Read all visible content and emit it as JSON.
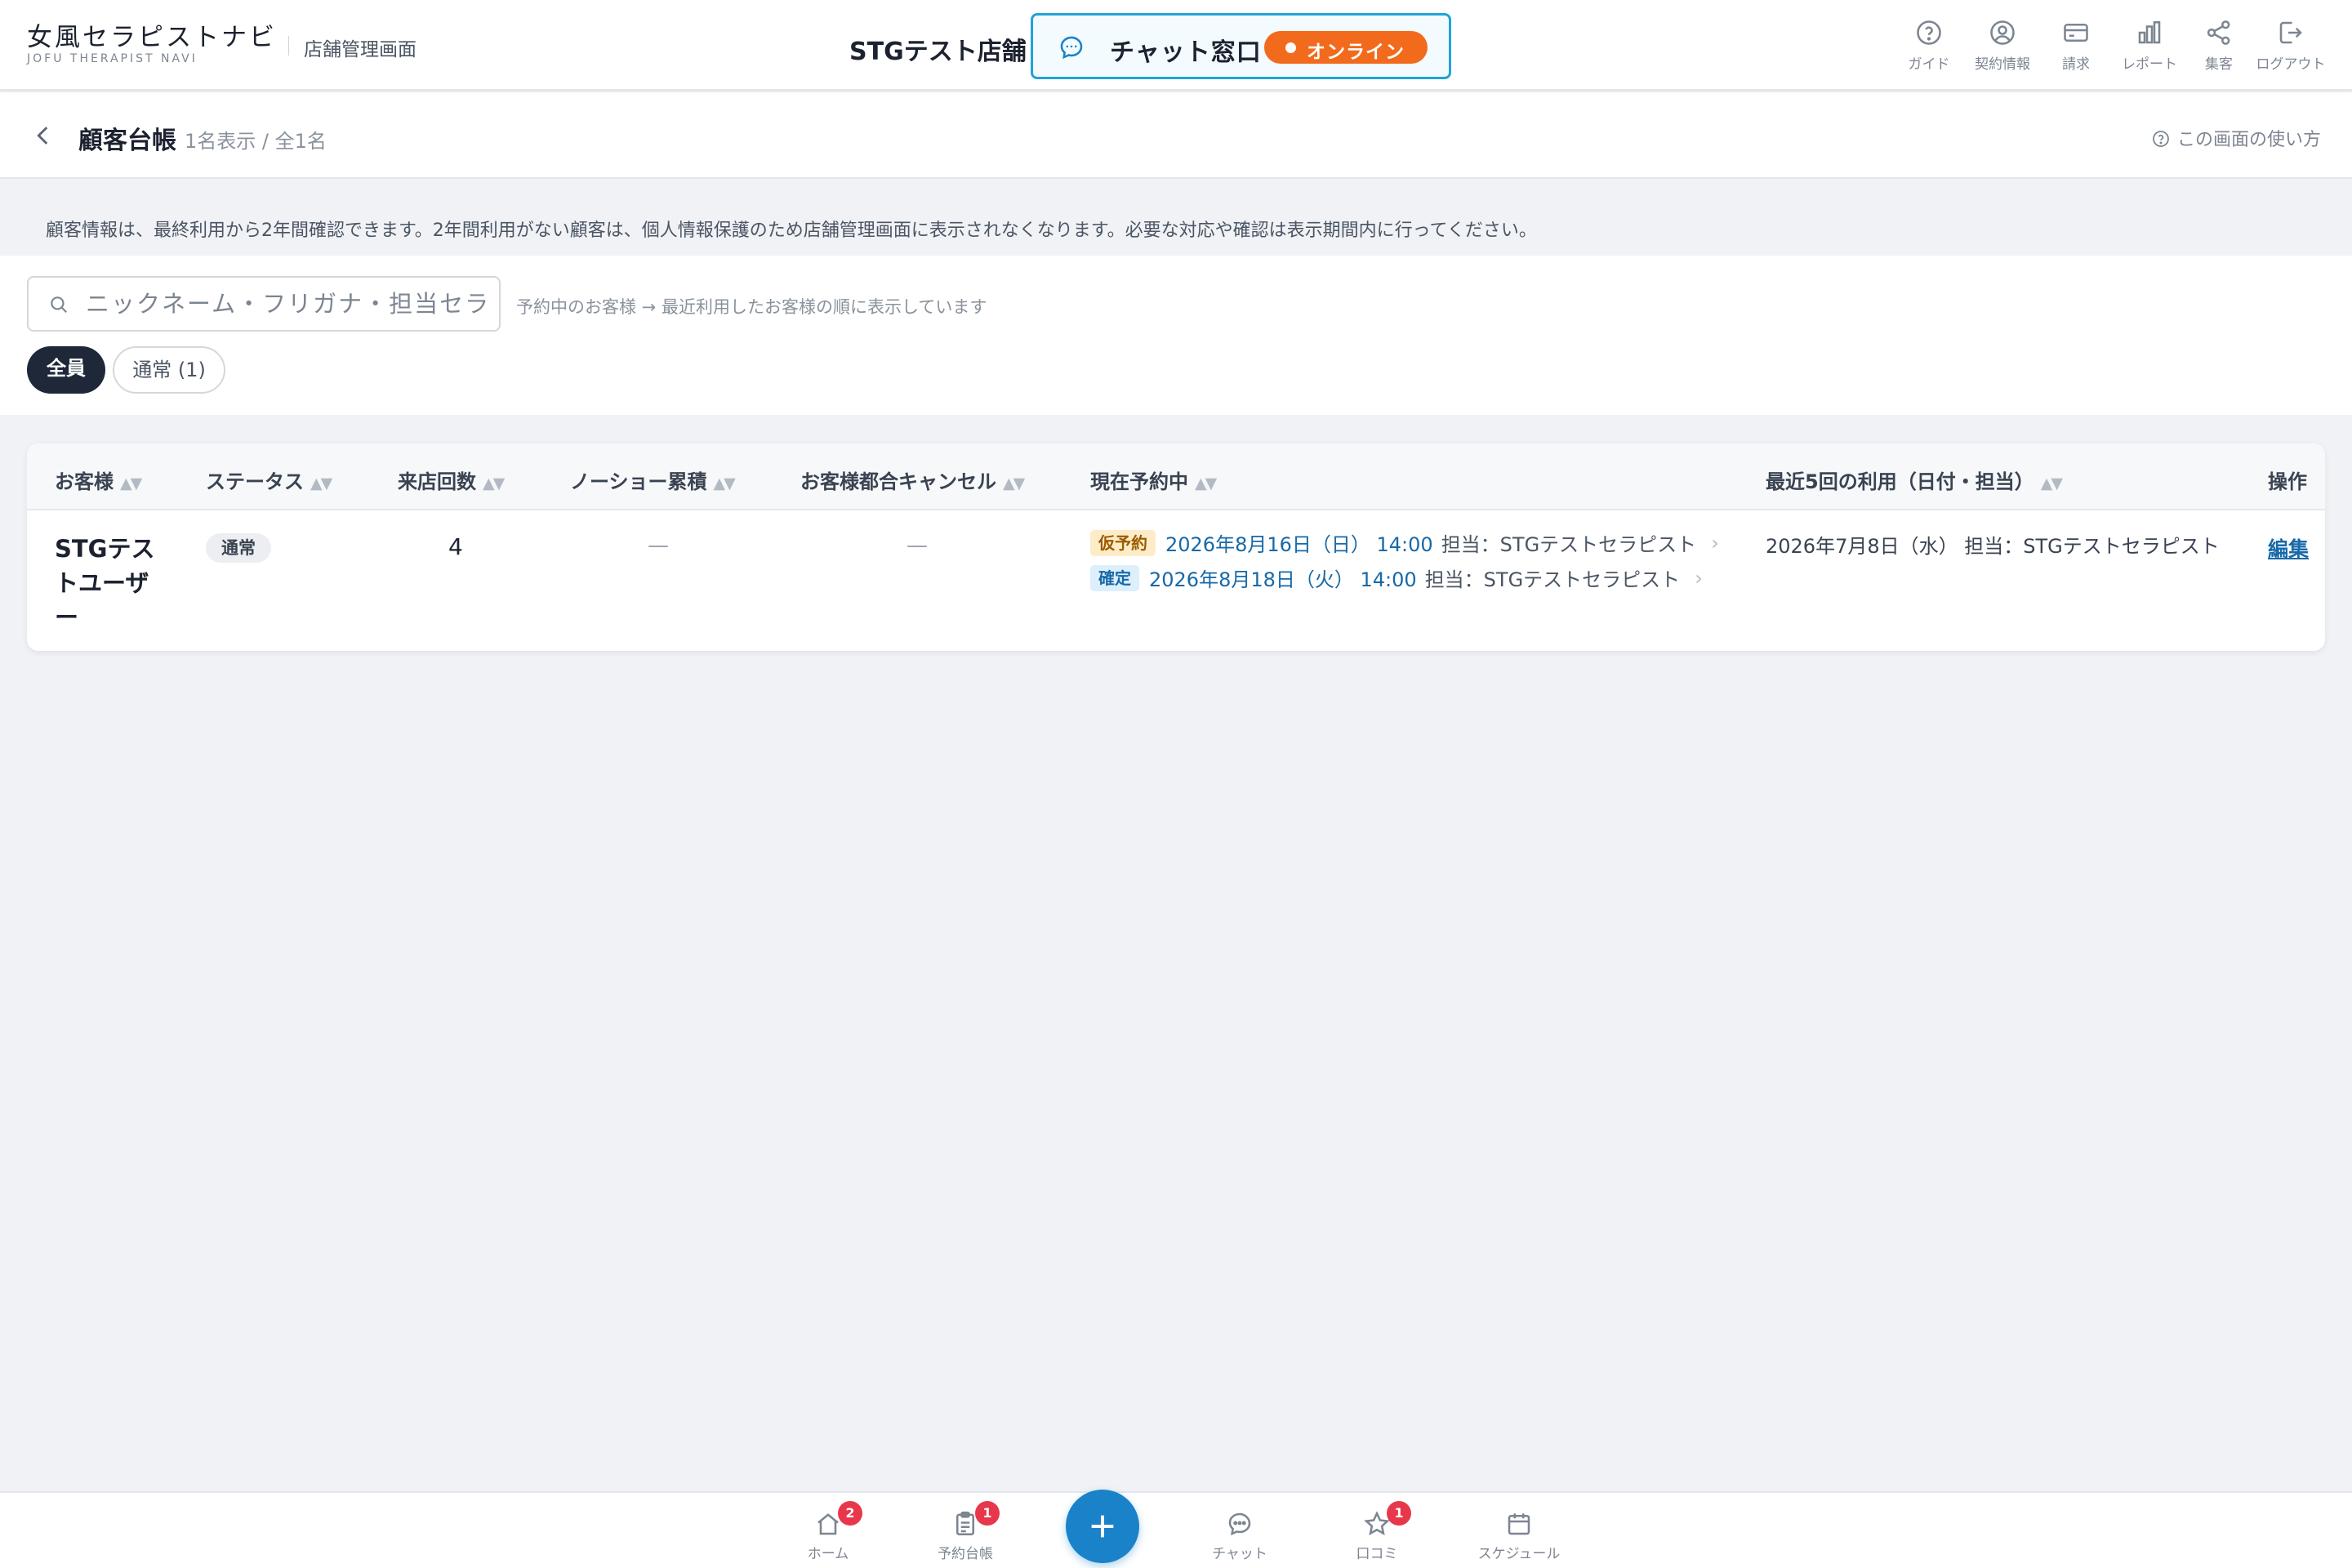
{
  "header": {
    "logo": "女風セラピストナビ",
    "logo_sub": "JOFU THERAPIST NAVI",
    "admin_label": "店舗管理画面",
    "store_name": "STGテスト店舗",
    "chat_label": "チャット窓口",
    "chat_status": "オンライン",
    "nav": [
      {
        "label": "ガイド",
        "icon": "question-circle-icon"
      },
      {
        "label": "契約情報",
        "icon": "user-circle-icon"
      },
      {
        "label": "請求",
        "icon": "credit-card-icon"
      },
      {
        "label": "レポート",
        "icon": "bar-chart-icon"
      },
      {
        "label": "集客",
        "icon": "share-icon"
      },
      {
        "label": "ログアウト",
        "icon": "logout-icon"
      }
    ]
  },
  "page": {
    "title": "顧客台帳",
    "count": "1名表示 / 全1名",
    "help": "この画面の使い方"
  },
  "notice": "顧客情報は、最終利用から2年間確認できます。2年間利用がない顧客は、個人情報保護のため店舗管理画面に表示されなくなります。必要な対応や確認は表示期間内に行ってください。",
  "search": {
    "placeholder": "ニックネーム・フリガナ・担当セラピスト",
    "hint": "予約中のお客様 → 最近利用したお客様の順に表示しています"
  },
  "filters": {
    "all": "全員",
    "normal": "通常 (1)"
  },
  "table": {
    "headers": {
      "customer": "お客様",
      "status": "ステータス",
      "visits": "来店回数",
      "noshow": "ノーショー累積",
      "cancel": "お客様都合キャンセル",
      "current": "現在予約中",
      "recent": "最近5回の利用（日付・担当）",
      "action": "操作"
    },
    "sort_glyph": "▲▼",
    "rows": [
      {
        "name": "STGテストユーザー",
        "status": "通常",
        "visits": "4",
        "noshow": "—",
        "cancel": "—",
        "reservations": [
          {
            "tag": "仮予約",
            "date": "2026年8月16日（日） 14:00",
            "staff": "担当：STGテストセラピスト"
          },
          {
            "tag": "確定",
            "date": "2026年8月18日（火） 14:00",
            "staff": "担当：STGテストセラピスト"
          }
        ],
        "recent": "2026年7月8日（水） 担当：STGテストセラピスト",
        "action": "編集"
      }
    ]
  },
  "bottom_nav": [
    {
      "label": "ホーム",
      "badge": "2",
      "icon": "home-icon"
    },
    {
      "label": "予約台帳",
      "badge": "1",
      "icon": "clipboard-icon"
    },
    {
      "label": "チャット",
      "badge": "",
      "icon": "chat-bubble-icon"
    },
    {
      "label": "口コミ",
      "badge": "1",
      "icon": "star-icon"
    },
    {
      "label": "スケジュール",
      "badge": "",
      "icon": "calendar-icon"
    }
  ],
  "colors": {
    "accent": "#1a82c8",
    "online": "#f26b1d",
    "chat_border": "#1ea5d8",
    "badge": "#e8374a",
    "dark_chip": "#1e2838"
  }
}
